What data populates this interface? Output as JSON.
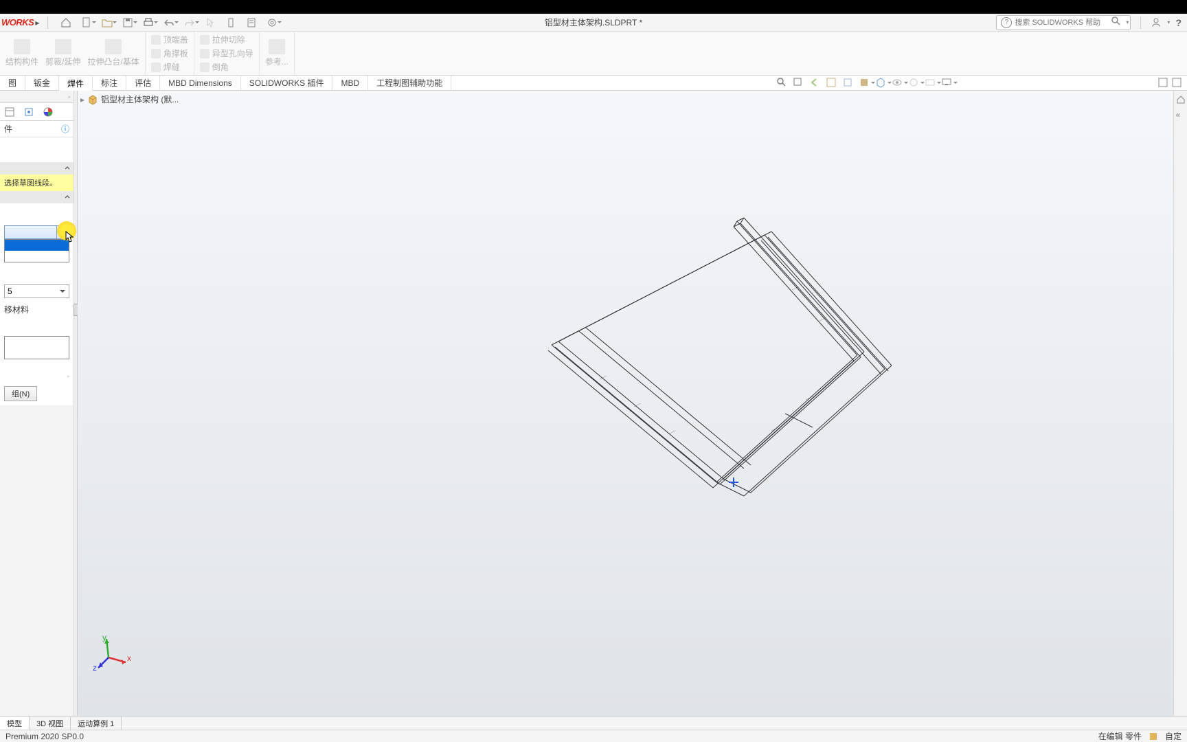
{
  "app": {
    "logo": "WORKS",
    "doc_title": "铝型材主体架构.SLDPRT *",
    "search_placeholder": "搜索 SOLIDWORKS 帮助"
  },
  "ribbon": {
    "g1": {
      "a": "结构构件",
      "b": "剪裁/延伸",
      "c": "拉伸凸台/基体"
    },
    "g2": {
      "a": "顶端盖",
      "b": "角撑板",
      "c": "焊缝"
    },
    "g3": {
      "a": "拉伸切除",
      "b": "异型孔向导",
      "c": "倒角"
    },
    "g4": {
      "a": "参考..."
    }
  },
  "tabs": [
    "图",
    "钣金",
    "焊件",
    "标注",
    "评估",
    "MBD Dimensions",
    "SOLIDWORKS 插件",
    "MBD",
    "工程制图辅助功能"
  ],
  "active_tab_index": 2,
  "panel": {
    "title": "件",
    "hint": "选择草图线段。",
    "dd2_value": "5",
    "checkbox_label": "移材料",
    "button_label": "组(N)"
  },
  "tree": {
    "root": "铝型材主体架构  (默..."
  },
  "bottom_tabs": [
    "模型",
    "3D 视图",
    "运动算例 1"
  ],
  "status": {
    "left": "Premium 2020 SP0.0",
    "right": "在编辑 零件",
    "far_right": "自定"
  },
  "triad_labels": {
    "x": "x",
    "y": "y",
    "z": "z"
  }
}
